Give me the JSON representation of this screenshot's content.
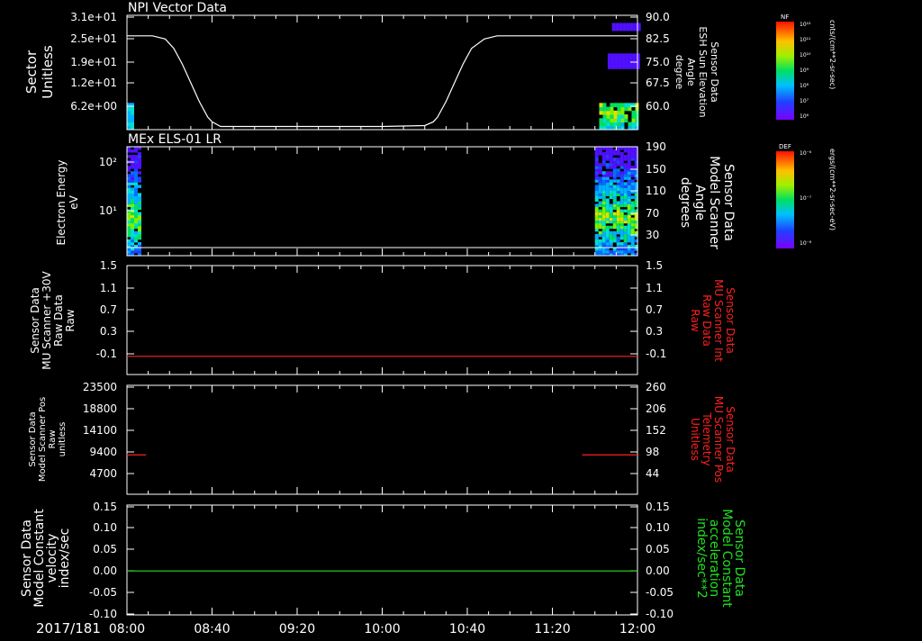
{
  "colors": {
    "background": "#000000",
    "axis": "#ffffff",
    "trace_white": "#ffffff",
    "trace_red": "#ff2020",
    "trace_green": "#20e020",
    "label_red": "#ff2020",
    "label_green": "#20e020"
  },
  "x_axis": {
    "date_label": "2017/181",
    "tick_labels": [
      "08:00",
      "08:40",
      "09:20",
      "10:00",
      "10:40",
      "11:20",
      "12:00"
    ],
    "start_minutes": 0,
    "end_minutes": 240
  },
  "colorbars": [
    {
      "title": "NF",
      "unit": "cnts/(cm**2-sr-sec)",
      "tick_labels": [
        "10¹²",
        "10¹¹",
        "10¹⁰",
        "10⁹",
        "10⁸",
        "10⁷",
        "10⁶"
      ]
    },
    {
      "title": "DEF",
      "unit": "ergs/(cm**2-sr-sec-eV)",
      "tick_labels": [
        "10⁻⁶",
        "10⁻⁷",
        "10⁻⁸"
      ]
    }
  ],
  "chart_data": [
    {
      "type": "heatmap",
      "panel_title": "NPI Vector Data",
      "left_label": [
        "Sector",
        "Unitless"
      ],
      "left_ticks": [
        "3.1e+01",
        "2.5e+01",
        "1.9e+01",
        "1.2e+01",
        "6.2e+00"
      ],
      "right_label": [
        "Sensor Data",
        "ESH Sun Elevation",
        "Angle",
        "degree"
      ],
      "right_ticks": [
        "90.0",
        "82.5",
        "75.0",
        "67.5",
        "60.0"
      ],
      "right_range": [
        54,
        90
      ],
      "line_series": {
        "name": "ESH Sun Elevation Angle",
        "x_minutes": [
          0,
          12,
          18,
          22,
          26,
          30,
          34,
          38,
          40,
          44,
          60,
          90,
          120,
          140,
          144,
          146,
          150,
          154,
          158,
          162,
          168,
          174,
          240
        ],
        "values": [
          84,
          84,
          83,
          80,
          75,
          69,
          63,
          58,
          56.5,
          55,
          55,
          55,
          55,
          55.3,
          56.5,
          58,
          63,
          69,
          75,
          80,
          83,
          84,
          84
        ]
      },
      "heatmap_blocks": [
        {
          "x_start": 0,
          "x_end": 1,
          "y_bins": [
            0,
            7
          ],
          "level": "high"
        },
        {
          "x_start": 222,
          "x_end": 240,
          "y_bins": [
            0,
            7
          ],
          "level": "mixed"
        },
        {
          "x_start": 226,
          "x_end": 240,
          "y_bins": [
            16,
            20
          ],
          "level": "low"
        },
        {
          "x_start": 228,
          "x_end": 240,
          "y_bins": [
            26,
            28
          ],
          "level": "low"
        }
      ]
    },
    {
      "type": "heatmap",
      "panel_title": "MEx ELS-01 LR",
      "left_label": [
        "Electron Energy",
        "eV"
      ],
      "left_ticks": [
        "10²",
        "10¹"
      ],
      "right_label": [
        "Sensor Data",
        "Model Scanner",
        "Angle",
        "degrees"
      ],
      "right_ticks": [
        "190",
        "150",
        "110",
        "70",
        "30"
      ],
      "right_range": [
        0,
        190
      ],
      "line_series": {
        "name": "Scanner Angle",
        "x_minutes": [
          0,
          240
        ],
        "values": [
          2,
          2
        ]
      },
      "heatmap_blocks": [
        {
          "x_start": 0,
          "x_end": 6,
          "y_bins": [
            0,
            40
          ],
          "level": "mixed"
        },
        {
          "x_start": 220,
          "x_end": 240,
          "y_bins": [
            0,
            40
          ],
          "level": "mixed"
        }
      ]
    },
    {
      "type": "line",
      "left_label": [
        "Sensor Data",
        "MU Scanner +30V",
        "Raw Data",
        "Raw"
      ],
      "left_ticks": [
        "1.5",
        "1.1",
        "0.7",
        "0.3",
        "-0.1"
      ],
      "right_label": [
        "Sensor Data",
        "MU Scanner Int",
        "Raw Data",
        "Raw"
      ],
      "right_ticks": [
        "1.5",
        "1.1",
        "0.7",
        "0.3",
        "-0.1"
      ],
      "ylim": [
        -0.3,
        1.5
      ],
      "series": [
        {
          "name": "MU Scanner +30V Raw Data",
          "x_minutes": [
            0,
            240
          ],
          "values": [
            0.0,
            0.0
          ]
        }
      ]
    },
    {
      "type": "line",
      "left_label": [
        "Sensor Data",
        "Model Scanner Pos",
        "Raw",
        "unitless"
      ],
      "left_ticks": [
        "23500",
        "18800",
        "14100",
        "9400",
        "4700"
      ],
      "right_label": [
        "Sensor Data",
        "MU Scanner Pos",
        "Telemetry",
        "Unitless"
      ],
      "right_ticks": [
        "260",
        "206",
        "152",
        "98",
        "44"
      ],
      "ylim": [
        0,
        23500
      ],
      "series": [
        {
          "name": "Model Scanner Pos",
          "x_minutes": [
            0,
            9
          ],
          "values": [
            8500,
            8500
          ]
        },
        {
          "name": "Model Scanner Pos",
          "x_minutes": [
            214,
            240
          ],
          "values": [
            8500,
            8500
          ]
        }
      ]
    },
    {
      "type": "line",
      "left_label": [
        "Sensor Data",
        "Model Constant",
        "velocity",
        "index/sec"
      ],
      "left_ticks": [
        "0.15",
        "0.10",
        "0.05",
        "0.00",
        "-0.05",
        "-0.10"
      ],
      "right_label": [
        "Sensor Data",
        "Model Constant",
        "acceleration",
        "index/sec**2"
      ],
      "right_ticks": [
        "0.15",
        "0.10",
        "0.05",
        "0.00",
        "-0.05",
        "-0.10"
      ],
      "ylim": [
        -0.1,
        0.15
      ],
      "series": [
        {
          "name": "Model Constant velocity",
          "x_minutes": [
            0,
            240
          ],
          "values": [
            0.0,
            0.0
          ]
        }
      ]
    }
  ]
}
